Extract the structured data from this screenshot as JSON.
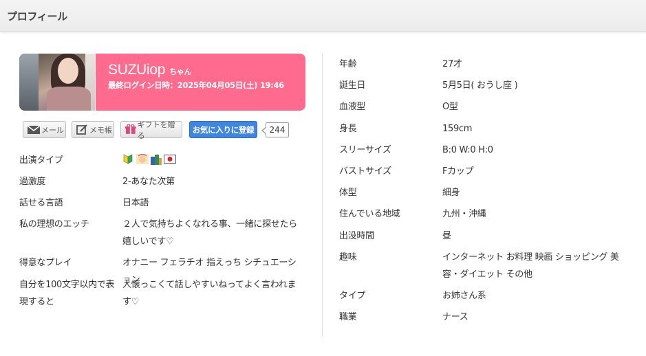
{
  "header": {
    "title": "プロフィール"
  },
  "profile": {
    "name": "SUZUiop",
    "honorific": "ちゃん",
    "last_login": "最終ログイン日時：2025年04月05日(土) 19:46"
  },
  "actions": {
    "mail_label": "メール",
    "memo_label": "メモ帳",
    "gift_label": "ギフトを贈る",
    "favorite_label": "お気に入りに登録",
    "favorite_count": "244"
  },
  "left_info": [
    {
      "label": "出演タイプ",
      "value": ""
    },
    {
      "label": "過激度",
      "value": "2-あなた次第"
    },
    {
      "label": "話せる言語",
      "value": "日本語"
    },
    {
      "label": "私の理想のエッチ",
      "value": "２人で気持ちよくなれる事、一緒に探せたら嬉しいです♡"
    },
    {
      "label": "得意なプレイ",
      "value": "オナニー フェラチオ 指えっち シチュエーション"
    },
    {
      "label": "自分を100文字以内で表現すると",
      "value": "人懐っこくて話しやすいねってよく言われます♡"
    }
  ],
  "type_icons": [
    "beginner-mark-icon",
    "face-icon",
    "building-icon",
    "flag-icon"
  ],
  "right_info": [
    {
      "label": "年齢",
      "value": "27才"
    },
    {
      "label": "誕生日",
      "value": "5月5日( おうし座 )"
    },
    {
      "label": "血液型",
      "value": "O型"
    },
    {
      "label": "身長",
      "value": "159cm"
    },
    {
      "label": "スリーサイズ",
      "value": "B:0 W:0 H:0"
    },
    {
      "label": "バストサイズ",
      "value": "Fカップ"
    },
    {
      "label": "体型",
      "value": "細身"
    },
    {
      "label": "住んでいる地域",
      "value": "九州・沖縄"
    },
    {
      "label": "出没時間",
      "value": "昼"
    },
    {
      "label": "趣味",
      "value": "インターネット お料理 映画 ショッピング 美容・ダイエット その他"
    },
    {
      "label": "タイプ",
      "value": "お姉さん系"
    },
    {
      "label": "職業",
      "value": "ナース"
    }
  ],
  "colors": {
    "accent_pink": "#ff6b8e",
    "button_blue": "#3f86e0"
  }
}
